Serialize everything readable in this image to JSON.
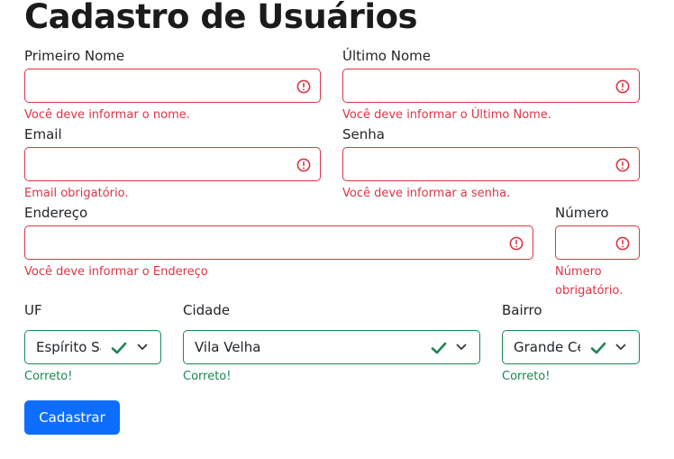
{
  "page_title": "Cadastro de Usuários",
  "fields": {
    "primeiro_nome": {
      "label": "Primeiro Nome",
      "value": "",
      "error": "Você deve informar o nome."
    },
    "ultimo_nome": {
      "label": "Último Nome",
      "value": "",
      "error": "Você deve informar o Último Nome."
    },
    "email": {
      "label": "Email",
      "value": "",
      "error": "Email obrigatório."
    },
    "senha": {
      "label": "Senha",
      "value": "",
      "error": "Você deve informar a senha."
    },
    "endereco": {
      "label": "Endereço",
      "value": "",
      "error": "Você deve informar o Endereço"
    },
    "numero": {
      "label": "Número",
      "value": "",
      "error_line1": "Número",
      "error_line2": "obrigatório."
    },
    "uf": {
      "label": "UF",
      "value": "Espírito Santo",
      "feedback": "Correto!"
    },
    "cidade": {
      "label": "Cidade",
      "value": "Vila Velha",
      "feedback": "Correto!"
    },
    "bairro": {
      "label": "Bairro",
      "value": "Grande Centro",
      "feedback": "Correto!"
    }
  },
  "submit_label": "Cadastrar",
  "colors": {
    "error": "#dc3545",
    "success": "#198754",
    "primary": "#0d6efd"
  },
  "icons": {
    "invalid": "exclamation-circle-icon",
    "valid": "check-icon",
    "dropdown": "chevron-down-icon"
  }
}
